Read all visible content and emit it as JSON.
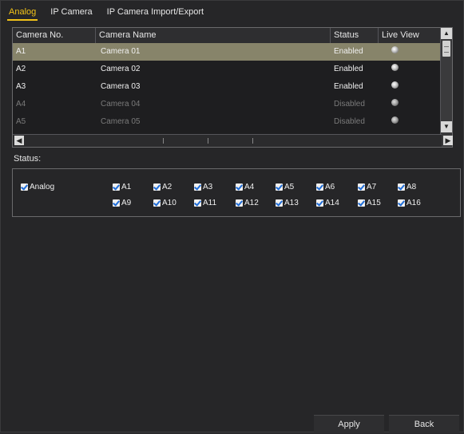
{
  "tabs": [
    {
      "label": "Analog",
      "active": true
    },
    {
      "label": "IP Camera",
      "active": false
    },
    {
      "label": "IP Camera Import/Export",
      "active": false
    }
  ],
  "table": {
    "headers": [
      "Camera No.",
      "Camera Name",
      "Status",
      "Live View"
    ],
    "rows": [
      {
        "no": "A1",
        "name": "Camera 01",
        "status": "Enabled",
        "selected": true,
        "enabled": true
      },
      {
        "no": "A2",
        "name": "Camera 02",
        "status": "Enabled",
        "selected": false,
        "enabled": true
      },
      {
        "no": "A3",
        "name": "Camera 03",
        "status": "Enabled",
        "selected": false,
        "enabled": true
      },
      {
        "no": "A4",
        "name": "Camera 04",
        "status": "Disabled",
        "selected": false,
        "enabled": false
      },
      {
        "no": "A5",
        "name": "Camera 05",
        "status": "Disabled",
        "selected": false,
        "enabled": false
      }
    ]
  },
  "status": {
    "label": "Status:",
    "group_label": "Analog",
    "channels": [
      "A1",
      "A2",
      "A3",
      "A4",
      "A5",
      "A6",
      "A7",
      "A8",
      "A9",
      "A10",
      "A11",
      "A12",
      "A13",
      "A14",
      "A15",
      "A16"
    ]
  },
  "buttons": {
    "apply": "Apply",
    "back": "Back"
  },
  "colors": {
    "accent": "#f2c218",
    "selected_row": "#87846a",
    "checkbox_check": "#1e6cd8"
  }
}
